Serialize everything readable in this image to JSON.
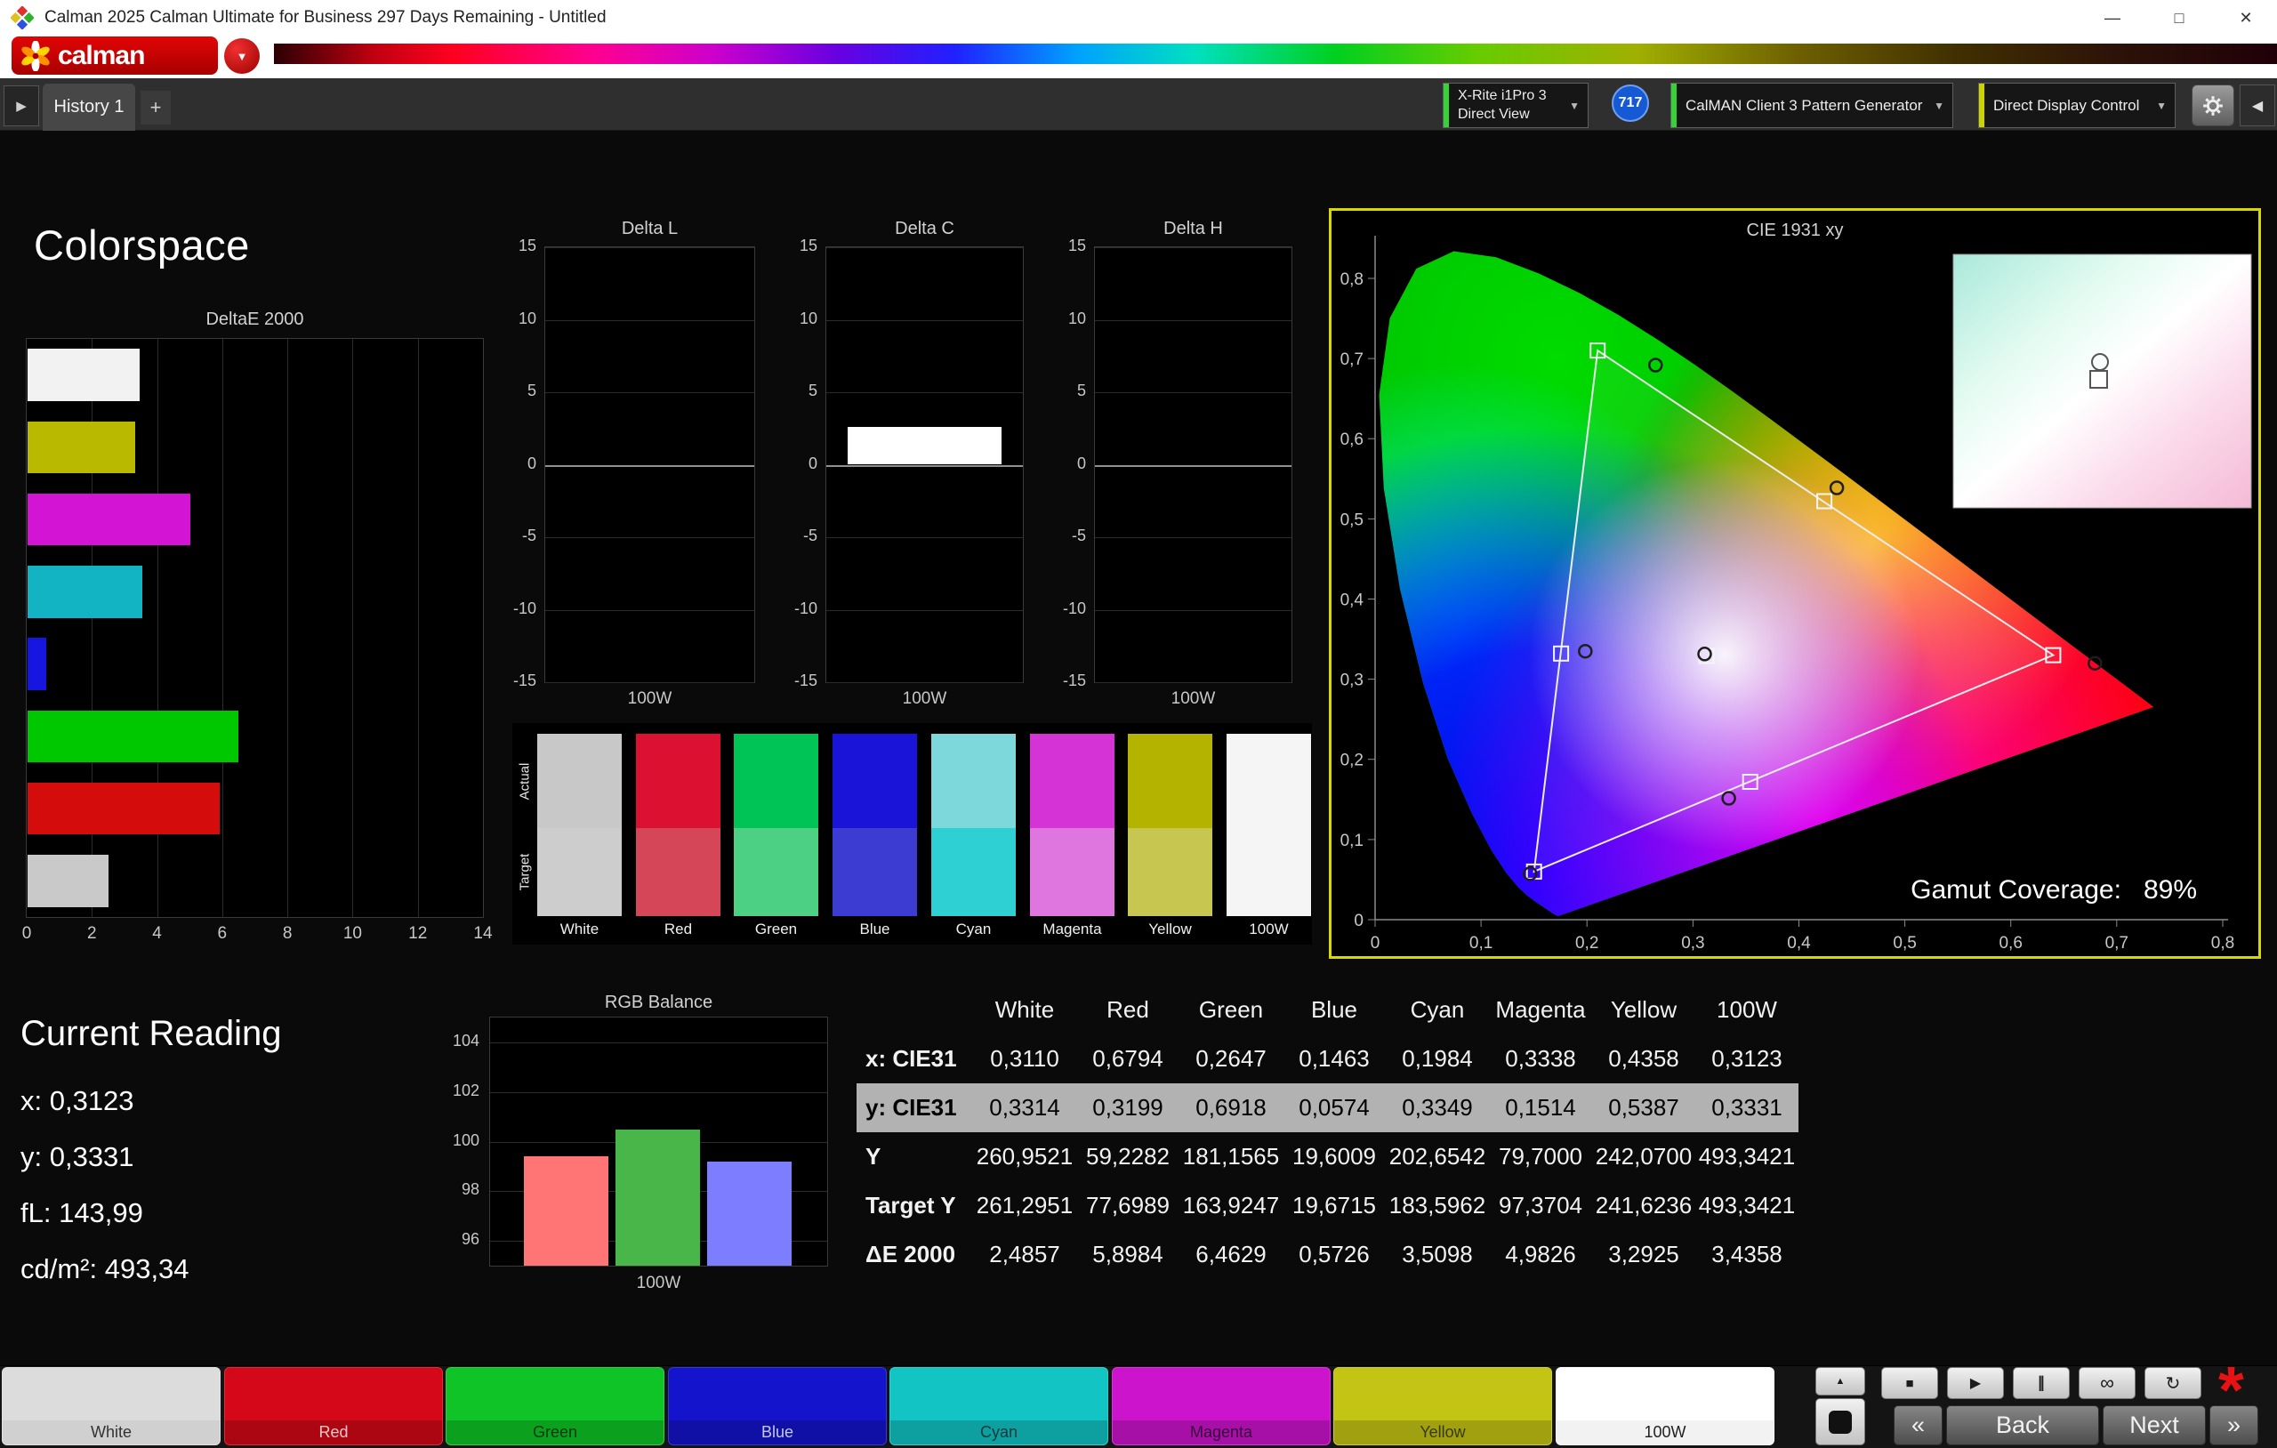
{
  "window": {
    "title": "Calman 2025 Calman Ultimate for Business 297 Days Remaining  - Untitled"
  },
  "icons": {
    "dropdown": "▼",
    "collapse": "◀",
    "expand": "▶",
    "add": "+",
    "minimize": "—",
    "maximize": "□",
    "close": "✕",
    "stop": "■",
    "play": "▶",
    "pause": "∥",
    "continuous": "∞",
    "refresh": "↻",
    "up": "▲",
    "page_prev": "«",
    "page_next": "»",
    "asterisk": "*"
  },
  "brand": {
    "logo_text": "calman"
  },
  "tab_bar": {
    "history_tab": "History 1",
    "add_tab": "+",
    "meter_line1": "X-Rite i1Pro 3",
    "meter_line2": "Direct View",
    "badge": "717",
    "pattern_generator": "CalMAN Client 3 Pattern Generator",
    "display_control": "Direct Display Control"
  },
  "page": {
    "title": "Colorspace"
  },
  "chart_data": [
    {
      "id": "deltae2000",
      "type": "bar",
      "orientation": "horizontal",
      "title": "DeltaE 2000",
      "categories": [
        "100W",
        "Yellow",
        "Magenta",
        "Cyan",
        "Blue",
        "Green",
        "Red",
        "White"
      ],
      "values": [
        3.4358,
        3.2925,
        4.9826,
        3.5098,
        0.5726,
        6.4629,
        5.8984,
        2.4857
      ],
      "colors": [
        "#f2f2f2",
        "#b9b900",
        "#d414d4",
        "#12b4c4",
        "#1616e0",
        "#00c800",
        "#d40c0c",
        "#c9c9c9"
      ],
      "xlim": [
        0,
        14
      ],
      "xticks": [
        0,
        2,
        4,
        6,
        8,
        10,
        12,
        14
      ]
    },
    {
      "id": "delta_l",
      "type": "bar",
      "title": "Delta L",
      "categories": [
        "100W"
      ],
      "values": [
        0
      ],
      "ylim": [
        -15,
        15
      ],
      "yticks": [
        15,
        10,
        5,
        0,
        -5,
        -10,
        -15
      ],
      "xlabel": "100W",
      "bar_color": "#ffffff"
    },
    {
      "id": "delta_c",
      "type": "bar",
      "title": "Delta C",
      "categories": [
        "100W"
      ],
      "values": [
        2.6
      ],
      "ylim": [
        -15,
        15
      ],
      "yticks": [
        15,
        10,
        5,
        0,
        -5,
        -10,
        -15
      ],
      "xlabel": "100W",
      "bar_color": "#ffffff"
    },
    {
      "id": "delta_h",
      "type": "bar",
      "title": "Delta H",
      "categories": [
        "100W"
      ],
      "values": [
        0
      ],
      "ylim": [
        -15,
        15
      ],
      "yticks": [
        15,
        10,
        5,
        0,
        -5,
        -10,
        -15
      ],
      "xlabel": "100W",
      "bar_color": "#ffffff"
    },
    {
      "id": "rgb_balance",
      "type": "bar",
      "title": "RGB Balance",
      "categories": [
        "Red",
        "Green",
        "Blue"
      ],
      "values": [
        99.4,
        100.5,
        99.2
      ],
      "colors": [
        "#ff7575",
        "#49b649",
        "#7d7dff"
      ],
      "ylim": [
        95,
        105
      ],
      "yticks": [
        96,
        98,
        100,
        102,
        104
      ],
      "xlabel": "100W"
    },
    {
      "id": "cie1931",
      "type": "scatter",
      "title": "CIE 1931 xy",
      "xlim": [
        0,
        0.8
      ],
      "ylim": [
        0,
        0.85
      ],
      "x_ticks": [
        "0",
        "0,1",
        "0,2",
        "0,3",
        "0,4",
        "0,5",
        "0,6",
        "0,7",
        "0,8"
      ],
      "y_ticks": [
        "0",
        "0,1",
        "0,2",
        "0,3",
        "0,4",
        "0,5",
        "0,6",
        "0,7",
        "0,8"
      ],
      "gamut_coverage_label": "Gamut Coverage:",
      "gamut_coverage_value": "89%",
      "target_triangle": [
        [
          0.64,
          0.33
        ],
        [
          0.21,
          0.71
        ],
        [
          0.15,
          0.06
        ]
      ],
      "target_points": [
        {
          "name": "White",
          "x": 0.3127,
          "y": 0.329
        },
        {
          "name": "Red",
          "x": 0.64,
          "y": 0.33
        },
        {
          "name": "Green",
          "x": 0.21,
          "y": 0.71
        },
        {
          "name": "Blue",
          "x": 0.15,
          "y": 0.06
        },
        {
          "name": "Cyan",
          "x": 0.1755,
          "y": 0.332
        },
        {
          "name": "Magenta",
          "x": 0.354,
          "y": 0.172
        },
        {
          "name": "Yellow",
          "x": 0.424,
          "y": 0.522
        }
      ],
      "measured_points": [
        {
          "name": "White",
          "x": 0.311,
          "y": 0.3314
        },
        {
          "name": "Red",
          "x": 0.6794,
          "y": 0.3199
        },
        {
          "name": "Green",
          "x": 0.2647,
          "y": 0.6918
        },
        {
          "name": "Blue",
          "x": 0.1463,
          "y": 0.0574
        },
        {
          "name": "Cyan",
          "x": 0.1984,
          "y": 0.3349
        },
        {
          "name": "Magenta",
          "x": 0.3338,
          "y": 0.1514
        },
        {
          "name": "Yellow",
          "x": 0.4358,
          "y": 0.5387
        }
      ]
    }
  ],
  "swatch_panel": {
    "row_labels": [
      "Actual",
      "Target"
    ],
    "columns": [
      {
        "label": "White",
        "actual": "#c8c8c8",
        "target": "#cdcdcd"
      },
      {
        "label": "Red",
        "actual": "#dc1030",
        "target": "#d44658"
      },
      {
        "label": "Green",
        "actual": "#00c455",
        "target": "#4cd084"
      },
      {
        "label": "Blue",
        "actual": "#1a14d8",
        "target": "#3c3cd2"
      },
      {
        "label": "Cyan",
        "actual": "#7cd8da",
        "target": "#2fd0d4"
      },
      {
        "label": "Magenta",
        "actual": "#d633d6",
        "target": "#df75df"
      },
      {
        "label": "Yellow",
        "actual": "#b4b400",
        "target": "#c6c650"
      },
      {
        "label": "100W",
        "actual": "#f5f5f5",
        "target": "#f5f5f5"
      }
    ]
  },
  "current_reading": {
    "title": "Current Reading",
    "lines": [
      "x: 0,3123",
      "y: 0,3331",
      "fL: 143,99",
      "cd/m²: 493,34"
    ]
  },
  "measurement_table": {
    "headers": [
      "",
      "White",
      "Red",
      "Green",
      "Blue",
      "Cyan",
      "Magenta",
      "Yellow",
      "100W"
    ],
    "rows": [
      {
        "label": "x: CIE31",
        "highlight": false,
        "values": [
          "0,3110",
          "0,6794",
          "0,2647",
          "0,1463",
          "0,1984",
          "0,3338",
          "0,4358",
          "0,3123"
        ]
      },
      {
        "label": "y: CIE31",
        "highlight": true,
        "values": [
          "0,3314",
          "0,3199",
          "0,6918",
          "0,0574",
          "0,3349",
          "0,1514",
          "0,5387",
          "0,3331"
        ]
      },
      {
        "label": "Y",
        "highlight": false,
        "values": [
          "260,9521",
          "59,2282",
          "181,1565",
          "19,6009",
          "202,6542",
          "79,7000",
          "242,0700",
          "493,3421"
        ]
      },
      {
        "label": "Target Y",
        "highlight": false,
        "values": [
          "261,2951",
          "77,6989",
          "163,9247",
          "19,6715",
          "183,5962",
          "97,3704",
          "241,6236",
          "493,3421"
        ]
      },
      {
        "label": "ΔE 2000",
        "highlight": false,
        "values": [
          "2,4857",
          "5,8984",
          "6,4629",
          "0,5726",
          "3,5098",
          "4,9826",
          "3,2925",
          "3,4358"
        ]
      }
    ]
  },
  "bottom_bar": {
    "patterns": [
      {
        "label": "White",
        "color": "#dcdcdc",
        "label_color": "#333333"
      },
      {
        "label": "Red",
        "color": "#d40818",
        "label_color": "#e8c6c6"
      },
      {
        "label": "Green",
        "color": "#0fc426",
        "label_color": "#073a0e"
      },
      {
        "label": "Blue",
        "color": "#1414cc",
        "label_color": "#c6c6e8"
      },
      {
        "label": "Cyan",
        "color": "#12c4c4",
        "label_color": "#073a3a"
      },
      {
        "label": "Magenta",
        "color": "#cc14cc",
        "label_color": "#3a073a"
      },
      {
        "label": "Yellow",
        "color": "#c4c414",
        "label_color": "#3a3a07"
      },
      {
        "label": "100W",
        "color": "#ffffff",
        "label_color": "#222222"
      }
    ],
    "back_label": "Back",
    "next_label": "Next"
  }
}
